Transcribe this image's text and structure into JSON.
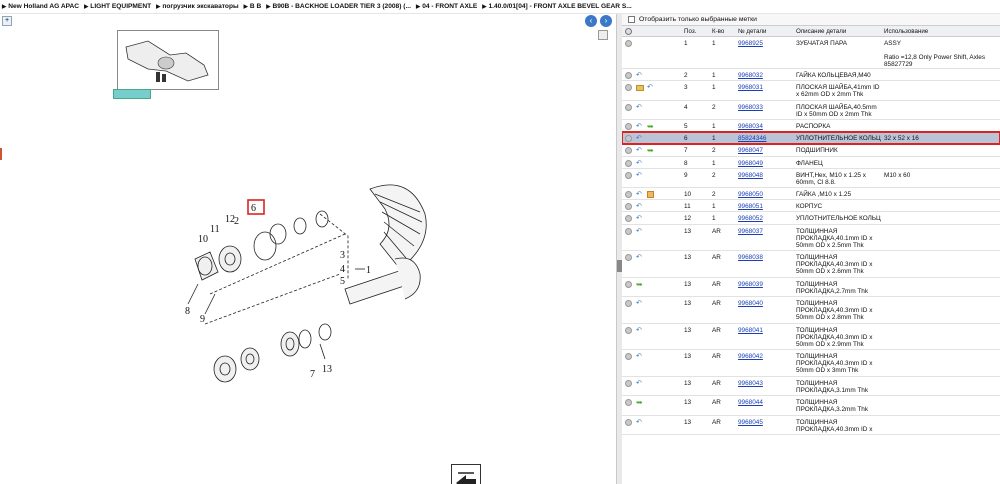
{
  "breadcrumb": [
    "New Holland AG APAC",
    "LIGHT EQUIPMENT",
    "погрузчик экскаваторы",
    "B B",
    "B90B - BACKHOE LOADER TIER 3 (2008) (...",
    "04 - FRONT AXLE",
    "1.40.0/01[04] - FRONT AXLE BEVEL GEAR S..."
  ],
  "filter": {
    "label": "Отобразить только выбранные метки"
  },
  "columns": {
    "pos": "Поз.",
    "qty": "К-во",
    "part": "№ детали",
    "desc": "Описание детали",
    "use": "Использование"
  },
  "diagram": {
    "callouts": [
      "1",
      "2",
      "3",
      "4",
      "5",
      "6",
      "7",
      "8",
      "9",
      "10",
      "11",
      "12",
      "13"
    ],
    "highlight_callout": "6"
  },
  "colors": {
    "link": "#1a3fb8",
    "selected_row": "#b9c5d6",
    "highlight": "#d22222",
    "nav_button": "#3a78c8"
  },
  "rows": [
    {
      "icons": [
        "grey"
      ],
      "pos": "1",
      "qty": "1",
      "part": "9968925",
      "desc": "ЗУБЧАТАЯ ПАРА",
      "use": "ASSY",
      "use2": "Ratio =12,8 Only Power Shift, Axles 85827729",
      "selected": false
    },
    {
      "icons": [
        "grey",
        "blue"
      ],
      "pos": "2",
      "qty": "1",
      "part": "9968032",
      "desc": "ГАЙКА КОЛЬЦЕВАЯ,M40",
      "use": "",
      "selected": false
    },
    {
      "icons": [
        "grey",
        "folder",
        "blue"
      ],
      "pos": "3",
      "qty": "1",
      "part": "9968031",
      "desc": "ПЛОСКАЯ ШАЙБА,41mm ID x 62mm OD x 2mm Thk",
      "use": "",
      "selected": false
    },
    {
      "icons": [
        "grey",
        "blue"
      ],
      "pos": "4",
      "qty": "2",
      "part": "9968033",
      "desc": "ПЛОСКАЯ ШАЙБА,40.5mm ID x 50mm OD x 2mm Thk",
      "use": "",
      "selected": false
    },
    {
      "icons": [
        "grey",
        "blue",
        "green"
      ],
      "pos": "5",
      "qty": "1",
      "part": "9968034",
      "desc": "РАСПОРКА",
      "use": "",
      "selected": false
    },
    {
      "icons": [
        "grey",
        "blue"
      ],
      "pos": "6",
      "qty": "1",
      "part": "85824346",
      "desc": "УПЛОТНИТЕЛЬНОЕ КОЛЬЦ",
      "use": "32 x 52 x 16",
      "selected": true
    },
    {
      "icons": [
        "grey",
        "blue",
        "green"
      ],
      "pos": "7",
      "qty": "2",
      "part": "9968047",
      "desc": "ПОДШИПНИК",
      "use": "",
      "selected": false
    },
    {
      "icons": [
        "grey",
        "blue"
      ],
      "pos": "8",
      "qty": "1",
      "part": "9968049",
      "desc": "ФЛАНЕЦ",
      "use": "",
      "selected": false
    },
    {
      "icons": [
        "grey",
        "blue"
      ],
      "pos": "9",
      "qty": "2",
      "part": "9968048",
      "desc": "ВИНТ,Hex, M10 x 1.25 x 60mm, Cl 8.8.",
      "use": "M10 x 60",
      "selected": false
    },
    {
      "icons": [
        "grey",
        "blue",
        "cube"
      ],
      "pos": "10",
      "qty": "2",
      "part": "9968050",
      "desc": "ГАЙКА ,M10 x 1.25",
      "use": "",
      "selected": false
    },
    {
      "icons": [
        "grey",
        "blue"
      ],
      "pos": "11",
      "qty": "1",
      "part": "9968051",
      "desc": "КОРПУС",
      "use": "",
      "selected": false
    },
    {
      "icons": [
        "grey",
        "blue"
      ],
      "pos": "12",
      "qty": "1",
      "part": "9968052",
      "desc": "УПЛОТНИТЕЛЬНОЕ КОЛЬЦ",
      "use": "",
      "selected": false
    },
    {
      "icons": [
        "grey",
        "blue"
      ],
      "pos": "13",
      "qty": "AR",
      "part": "9968037",
      "desc": "ТОЛЩИННАЯ ПРОКЛАДКА,40.1mm ID x 50mm OD x 2.5mm Thk",
      "use": "",
      "selected": false
    },
    {
      "icons": [
        "grey",
        "blue"
      ],
      "pos": "13",
      "qty": "AR",
      "part": "9968038",
      "desc": "ТОЛЩИННАЯ ПРОКЛАДКА,40.3mm ID x 50mm OD x 2.6mm Thk",
      "use": "",
      "selected": false
    },
    {
      "icons": [
        "grey",
        "green"
      ],
      "pos": "13",
      "qty": "AR",
      "part": "9968039",
      "desc": "ТОЛЩИННАЯ ПРОКЛАДКА,2.7mm Thk",
      "use": "",
      "selected": false
    },
    {
      "icons": [
        "grey",
        "blue"
      ],
      "pos": "13",
      "qty": "AR",
      "part": "9968040",
      "desc": "ТОЛЩИННАЯ ПРОКЛАДКА,40.3mm ID x 50mm OD x 2.8mm Thk",
      "use": "",
      "selected": false
    },
    {
      "icons": [
        "grey",
        "blue"
      ],
      "pos": "13",
      "qty": "AR",
      "part": "9968041",
      "desc": "ТОЛЩИННАЯ ПРОКЛАДКА,40.3mm ID x 50mm OD x 2.9mm Thk",
      "use": "",
      "selected": false
    },
    {
      "icons": [
        "grey",
        "blue"
      ],
      "pos": "13",
      "qty": "AR",
      "part": "9968042",
      "desc": "ТОЛЩИННАЯ ПРОКЛАДКА,40.3mm ID x 50mm OD x 3mm Thk",
      "use": "",
      "selected": false
    },
    {
      "icons": [
        "grey",
        "blue"
      ],
      "pos": "13",
      "qty": "AR",
      "part": "9968043",
      "desc": "ТОЛЩИННАЯ ПРОКЛАДКА,3.1mm Thk",
      "use": "",
      "selected": false
    },
    {
      "icons": [
        "grey",
        "green"
      ],
      "pos": "13",
      "qty": "AR",
      "part": "9968044",
      "desc": "ТОЛЩИННАЯ ПРОКЛАДКА,3.2mm Thk",
      "use": "",
      "selected": false
    },
    {
      "icons": [
        "grey",
        "blue"
      ],
      "pos": "13",
      "qty": "AR",
      "part": "9968045",
      "desc": "ТОЛЩИННАЯ ПРОКЛАДКА,40.3mm ID x",
      "use": "",
      "selected": false
    }
  ]
}
